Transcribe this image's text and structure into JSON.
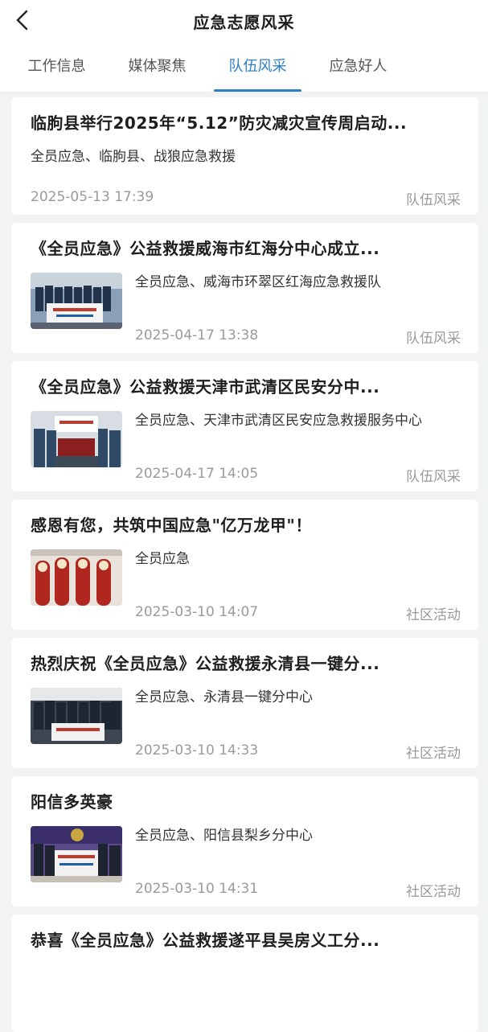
{
  "header": {
    "title": "应急志愿风采"
  },
  "tabs": [
    {
      "label": "工作信息"
    },
    {
      "label": "媒体聚焦"
    },
    {
      "label": "队伍风采"
    },
    {
      "label": "应急好人"
    }
  ],
  "articles": [
    {
      "title": "临朐县举行2025年“5.12”防灾减灾宣传周启动...",
      "tags": "全员应急、临朐县、战狼应急救援",
      "date": "2025-05-13 17:39",
      "category": "队伍风采",
      "has_image": false
    },
    {
      "title": "《全员应急》公益救援威海市红海分中心成立...",
      "tags": "全员应急、威海市环翠区红海应急救援队",
      "date": "2025-04-17 13:38",
      "category": "队伍风采",
      "has_image": true
    },
    {
      "title": "《全员应急》公益救援天津市武清区民安分中...",
      "tags": "全员应急、天津市武清区民安应急救援服务中心",
      "date": "2025-04-17 14:05",
      "category": "队伍风采",
      "has_image": true
    },
    {
      "title": "感恩有您，共筑中国应急\"亿万龙甲\"！",
      "tags": "全员应急",
      "date": "2025-03-10 14:07",
      "category": "社区活动",
      "has_image": true
    },
    {
      "title": "热烈庆祝《全员应急》公益救援永清县一键分...",
      "tags": "全员应急、永清县一键分中心",
      "date": "2025-03-10 14:33",
      "category": "社区活动",
      "has_image": true
    },
    {
      "title": "阳信多英豪",
      "tags": "全员应急、阳信县梨乡分中心",
      "date": "2025-03-10 14:31",
      "category": "社区活动",
      "has_image": true
    },
    {
      "title": "恭喜《全员应急》公益救援遂平县吴房义工分...",
      "tags": "",
      "date": "",
      "category": "",
      "has_image": false
    }
  ],
  "colors": {
    "accent": "#2d7fc6",
    "muted": "#9a9a9a"
  }
}
